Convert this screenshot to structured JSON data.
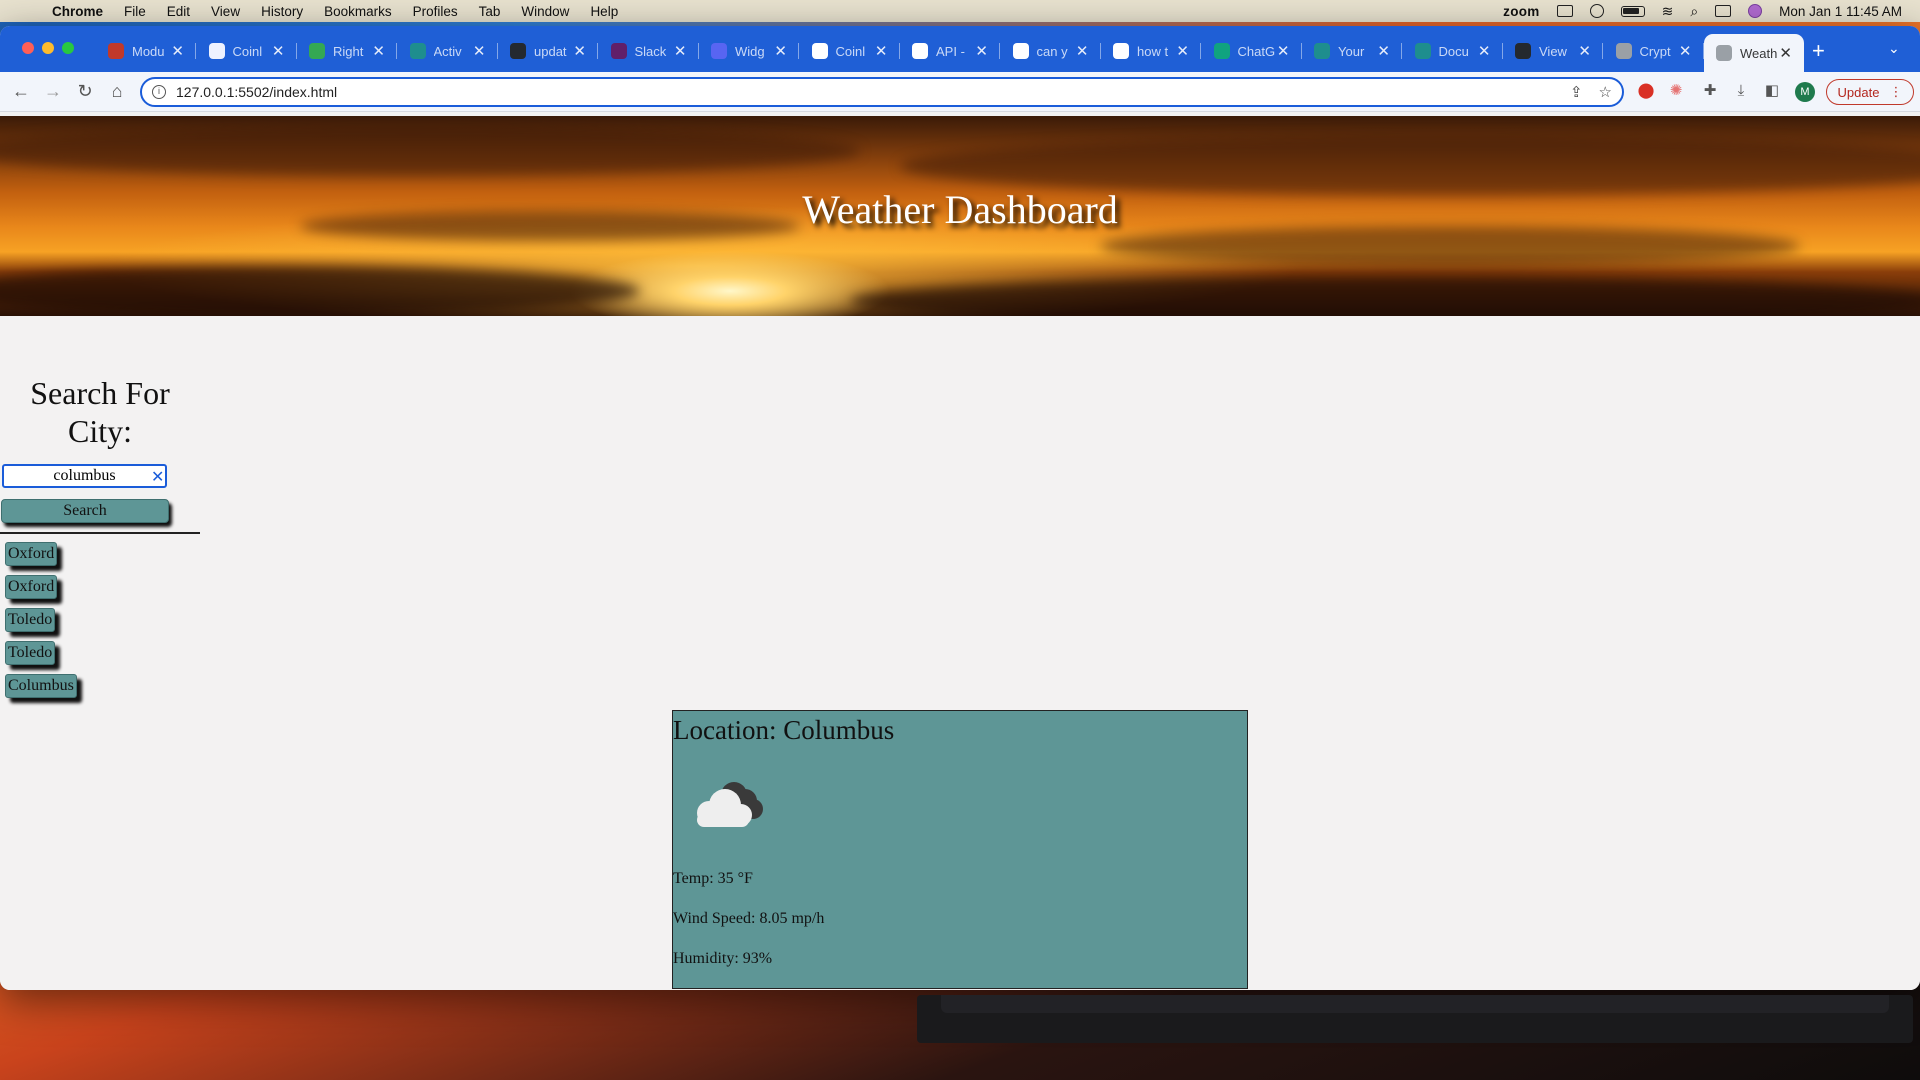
{
  "menubar": {
    "app_name": "Chrome",
    "items": [
      "File",
      "Edit",
      "View",
      "History",
      "Bookmarks",
      "Profiles",
      "Tab",
      "Window",
      "Help"
    ],
    "zoom_label": "zoom",
    "datetime": "Mon Jan 1  11:45 AM"
  },
  "browser": {
    "tabs": [
      {
        "title": "Modu",
        "color": "#c0392b"
      },
      {
        "title": "Coinl",
        "color": "#eef2ff"
      },
      {
        "title": "Right",
        "color": "#34a853"
      },
      {
        "title": "Activ",
        "color": "#1e8e8e"
      },
      {
        "title": "updat",
        "color": "#24292f"
      },
      {
        "title": "Slack",
        "color": "#611f69"
      },
      {
        "title": "Widg",
        "color": "#5865f2"
      },
      {
        "title": "Coinl",
        "color": "#ffffff"
      },
      {
        "title": "API -",
        "color": "#ffffff"
      },
      {
        "title": "can y",
        "color": "#ffffff"
      },
      {
        "title": "how t",
        "color": "#ffffff"
      },
      {
        "title": "ChatG",
        "color": "#10a37f"
      },
      {
        "title": "Your",
        "color": "#1e8e8e"
      },
      {
        "title": "Docu",
        "color": "#1e8e8e"
      },
      {
        "title": "View",
        "color": "#24292f"
      },
      {
        "title": "Crypt",
        "color": "#9aa0a6"
      },
      {
        "title": "Weath",
        "color": "#9aa0a6"
      }
    ],
    "url": "127.0.0.1:5502/index.html",
    "profile_initial": "M",
    "update_label": "Update"
  },
  "page": {
    "header_title": "Weather Dashboard",
    "sidebar": {
      "heading": "Search For City:",
      "search_value": "columbus",
      "search_button": "Search",
      "history": [
        "Oxford",
        "Oxford",
        "Toledo",
        "Toledo",
        "Columbus"
      ]
    },
    "card": {
      "location": "Location: Columbus",
      "icon": "cloud-icon",
      "temp": "Temp: 35 °F",
      "wind": "Wind Speed: 8.05 mp/h",
      "humidity": "Humidity: 93%",
      "background_color": "#5e9696"
    }
  }
}
